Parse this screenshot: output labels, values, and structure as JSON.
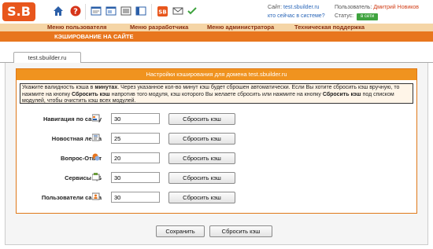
{
  "logo": "S.B",
  "toolbar": {
    "icons": [
      "home-icon",
      "help-icon",
      "edit-icon",
      "window-icon",
      "list-icon",
      "panel-icon",
      "sb-tools-icon",
      "mail-icon",
      "check-icon"
    ]
  },
  "site": {
    "site_label": "Сайт:",
    "site_url": "test.sbuilder.ru",
    "who_online": "кто сейчас в системе?"
  },
  "user": {
    "user_label": "Пользователь:",
    "user_name": "Дмитрий Новиков",
    "status_label": "Статус:",
    "status_value": "в сети"
  },
  "menu": {
    "items": [
      "Меню пользователя",
      "Меню разработчика",
      "Меню администратора",
      "Техническая поддержка"
    ]
  },
  "page_title": "КЭШИРОВАНИЕ НА САЙТЕ",
  "tab_label": "test.sbuilder.ru",
  "card": {
    "header": "Настройки кэширования для домена test.sbuilder.ru",
    "notice": {
      "part1": "Укажите валидность кэша в ",
      "bold1": "минутах",
      "part2": ". Через указанное кол-во минут кэш будет сброшен автоматически. Если Вы хотите сбросить кэш вручную, то нажмите на кнопку ",
      "bold2": "Сбросить кэш",
      "part3": " напротив того модуля, кэш которого Вы желаете сбросить или нажмите на кнопку ",
      "bold3": "Сбросить кэш",
      "part4": " под списком модулей, чтобы очистить кэш всех модулей."
    },
    "rows": [
      {
        "label": "Навигация по сайту",
        "value": "30",
        "button": "Сбросить кэш",
        "icon": "navigation-icon"
      },
      {
        "label": "Новостная лента",
        "value": "25",
        "button": "Сбросить кэш",
        "icon": "news-icon"
      },
      {
        "label": "Вопрос-Ответ",
        "value": "20",
        "button": "Сбросить кэш",
        "icon": "faq-icon"
      },
      {
        "label": "Сервисы ЦБ",
        "value": "30",
        "button": "Сбросить кэш",
        "icon": "cb-services-icon"
      },
      {
        "label": "Пользователи сайта",
        "value": "30",
        "button": "Сбросить кэш",
        "icon": "site-users-icon"
      }
    ]
  },
  "actions": {
    "save": "Сохранить",
    "reset_all": "Сбросить кэш"
  }
}
